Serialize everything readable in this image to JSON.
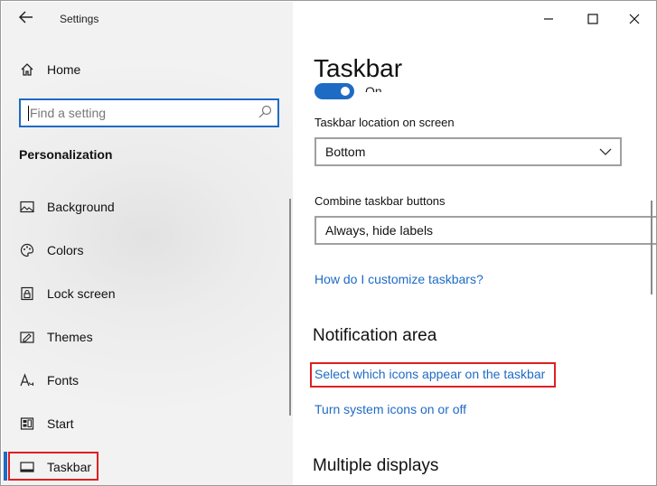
{
  "window": {
    "title": "Settings",
    "controls": {
      "minimize": "—",
      "maximize": "☐",
      "close": "✕"
    }
  },
  "sidebar": {
    "home_label": "Home",
    "search": {
      "placeholder": "Find a setting"
    },
    "section_label": "Personalization",
    "items": [
      {
        "label": "Background",
        "icon": "image-icon"
      },
      {
        "label": "Colors",
        "icon": "palette-icon"
      },
      {
        "label": "Lock screen",
        "icon": "lock-screen-icon"
      },
      {
        "label": "Themes",
        "icon": "themes-icon"
      },
      {
        "label": "Fonts",
        "icon": "fonts-icon"
      },
      {
        "label": "Start",
        "icon": "start-icon"
      },
      {
        "label": "Taskbar",
        "icon": "taskbar-icon",
        "selected": true
      }
    ]
  },
  "main": {
    "title": "Taskbar",
    "toggle": {
      "state": "On"
    },
    "location": {
      "label": "Taskbar location on screen",
      "value": "Bottom"
    },
    "combine": {
      "label": "Combine taskbar buttons",
      "value": "Always, hide labels"
    },
    "customize_link": "How do I customize taskbars?",
    "notification_area": {
      "heading": "Notification area",
      "select_icons_link": "Select which icons appear on the taskbar",
      "system_icons_link": "Turn system icons on or off"
    },
    "multiple_displays": {
      "heading": "Multiple displays"
    }
  },
  "colors": {
    "accent": "#1e6bc4",
    "highlight": "#e02020"
  }
}
